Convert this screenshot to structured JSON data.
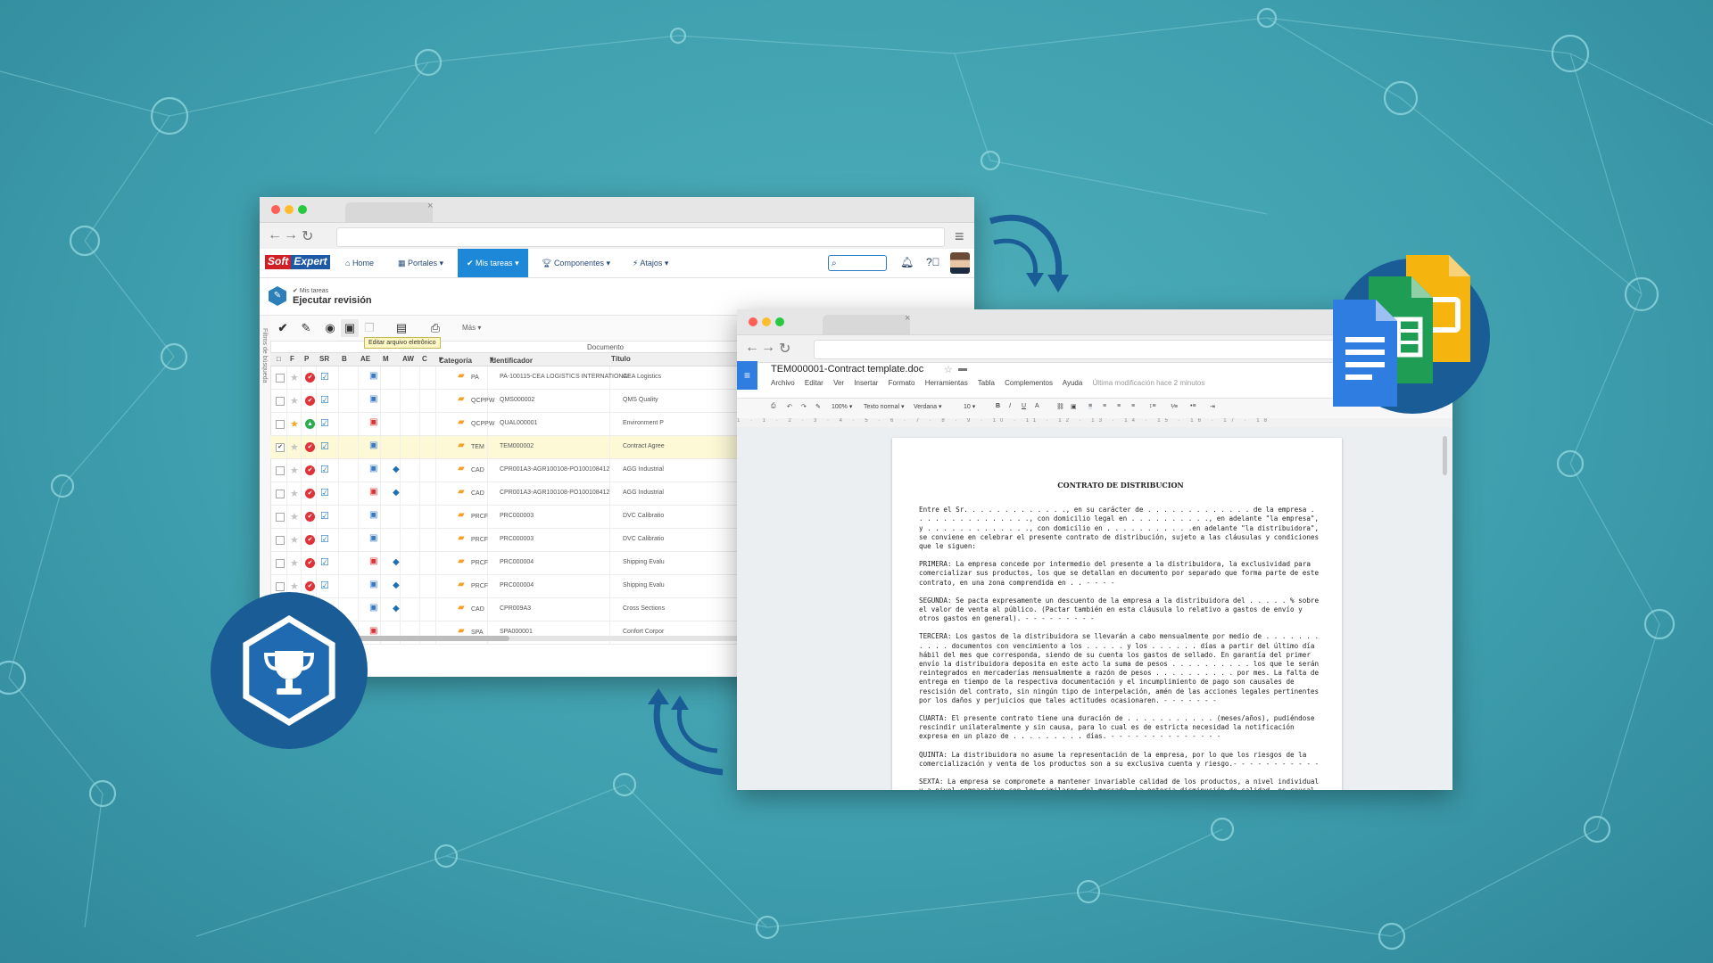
{
  "softexpert": {
    "logo": {
      "part1": "Soft",
      "part2": "Expert"
    },
    "nav": {
      "home": "Home",
      "portales": "Portales",
      "mis_tareas": "Mis tareas",
      "componentes": "Componentes",
      "atajos": "Atajos"
    },
    "breadcrumb": "Mis tareas",
    "page_title": "Ejecutar revisión",
    "toolbar": {
      "more": "Más",
      "tooltip": "Editar arquivo eletrônico"
    },
    "side_filter": "Filtros de búsqueda",
    "group_header": "Documento",
    "columns": [
      "F",
      "P",
      "SR",
      "B",
      "AE",
      "M",
      "AW",
      "C",
      "Categoría",
      "Identificador",
      "Título"
    ],
    "rows": [
      {
        "category": "PA",
        "id": "PA-100115-CEA LOGISTICS INTERNATIONAL",
        "title": "CEA Logistics",
        "starred": false,
        "status": "red",
        "selected": false
      },
      {
        "category": "QCPPW",
        "id": "QMS000002",
        "title": "QMS Quality",
        "starred": false,
        "status": "red",
        "selected": false
      },
      {
        "category": "QCPPW",
        "id": "QUAL000001",
        "title": "Environment P",
        "starred": true,
        "status": "green",
        "selected": false
      },
      {
        "category": "TEM",
        "id": "TEM000002",
        "title": "Contract Agree",
        "starred": false,
        "status": "red",
        "selected": true
      },
      {
        "category": "CAD",
        "id": "CPR001A3-AGR100108-PO100108412",
        "title": "AGG Industrial",
        "starred": false,
        "status": "red",
        "selected": false
      },
      {
        "category": "CAD",
        "id": "CPR001A3-AGR100108-PO100108412",
        "title": "AGG Industrial",
        "starred": false,
        "status": "red",
        "selected": false
      },
      {
        "category": "PRCF",
        "id": "PRC000003",
        "title": "DVC Calibratio",
        "starred": false,
        "status": "red",
        "selected": false
      },
      {
        "category": "PRCF",
        "id": "PRC000003",
        "title": "DVC Calibratio",
        "starred": false,
        "status": "red",
        "selected": false
      },
      {
        "category": "PRCF",
        "id": "PRC000004",
        "title": "Shipping Evalu",
        "starred": false,
        "status": "red",
        "selected": false
      },
      {
        "category": "PRCF",
        "id": "PRC000004",
        "title": "Shipping Evalu",
        "starred": false,
        "status": "red",
        "selected": false
      },
      {
        "category": "CAD",
        "id": "CPR009A3",
        "title": "Cross Sections",
        "starred": false,
        "status": "red",
        "selected": false
      },
      {
        "category": "SPA",
        "id": "SPA000001",
        "title": "Confort Corpor",
        "starred": false,
        "status": "red",
        "selected": false
      }
    ]
  },
  "gdocs": {
    "doc_name": "TEM000001-Contract template.doc",
    "menu": [
      "Archivo",
      "Editar",
      "Ver",
      "Insertar",
      "Formato",
      "Herramientas",
      "Tabla",
      "Complementos",
      "Ayuda"
    ],
    "last_edit": "Última modificación hace 2 minutos",
    "format": {
      "zoom": "100%",
      "style": "Texto normal",
      "font": "Verdana",
      "size": "10"
    },
    "ruler": "1 · 1 · 2 · 3 · 4 · 5 · 6 · 7 · 8 · 9 · 10 · 11 · 12 · 13 · 14 · 15 · 16 · 17 · 18",
    "document": {
      "title": "CONTRATO DE DISTRIBUCION",
      "paragraphs": [
        "Entre el Sr. . . . . . . . . . . . ., en su carácter de . . . . . . . . . . . . . de la empresa . . . . . . . . . . . . . . ., con domicilio legal en . . . . . . . . . ., en adelante \"la empresa\", y . . . . . . . . . . . . ., con domicilio en . . . . . . . . . . .en adelante \"la distribuidora\", se conviene en celebrar el presente contrato de distribución, sujeto a las cláusulas y condiciones que le siguen:",
        "PRIMERA: La empresa concede por intermedio del presente a la distribuidora, la exclusividad para comercializar sus productos, los que se detallan en documento por separado que forma parte de este contrato, en una zona comprendida en . . - - - -",
        "SEGUNDA: Se pacta expresamente un descuento de la empresa a la distribuidora del . . . . . % sobre el valor de venta al público. (Pactar también en esta cláusula lo relativo a gastos de envío y otros gastos en general). - - - - - - - - -",
        "TERCERA: Los gastos de la distribuidora se llevarán a cabo mensualmente por medio de . . . . . . . . . . . documentos con vencimiento a los . . . . . y los . . . . . . días a partir del último día hábil del mes que corresponda, siendo de su cuenta los gastos de sellado. En garantía del primer envío la distribuidora deposita en este acto la suma de pesos . . . . . . . . . . los que le serán reintegrados en mercaderías mensualmente a razón de pesos . . . . . . . . . . por mes. La falta de entrega en tiempo de la respectiva documentación y el incumplimiento de pago son causales de rescisión del contrato, sin ningún tipo de interpelación, amén de las acciones legales pertinentes por los daños y perjuicios que tales actitudes ocasionaren. - - - - - - -",
        "CUARTA: El presente contrato tiene una duración de . . . . . . . . . . . (meses/años), pudiéndose rescindir unilateralmente y sin causa, para lo cual es de estricta necesidad la notificación expresa en un plazo de . . . . . . . . . días. - - - - - - - - - - - - - -",
        "QUINTA: La distribuidora no asume la representación de la empresa, por lo que los riesgos de la comercialización y venta de los productos son a su exclusiva cuenta y riesgo.- - - - - - - - - - -",
        "SEXTA: La empresa se compromete a mantener invariable calidad de los productos, a nivel individual y a nivel comparativo con los similares del mercado. La notoria disminución de calidad, es causal de rescisión"
      ]
    }
  },
  "colors": {
    "background": "#3f9fae",
    "accent_blue": "#1e88d8",
    "badge_blue": "#1a5c96",
    "docs_blue": "#2f7de1",
    "sheets_green": "#1f9d55",
    "slides_yellow": "#f6b40e"
  },
  "icons": [
    "back-icon",
    "forward-icon",
    "reload-icon",
    "menu-icon",
    "home-icon",
    "bell-icon",
    "help-icon",
    "search-icon",
    "trophy-icon",
    "docs-icon",
    "sheets-icon",
    "slides-icon",
    "sync-arrow-icon"
  ]
}
